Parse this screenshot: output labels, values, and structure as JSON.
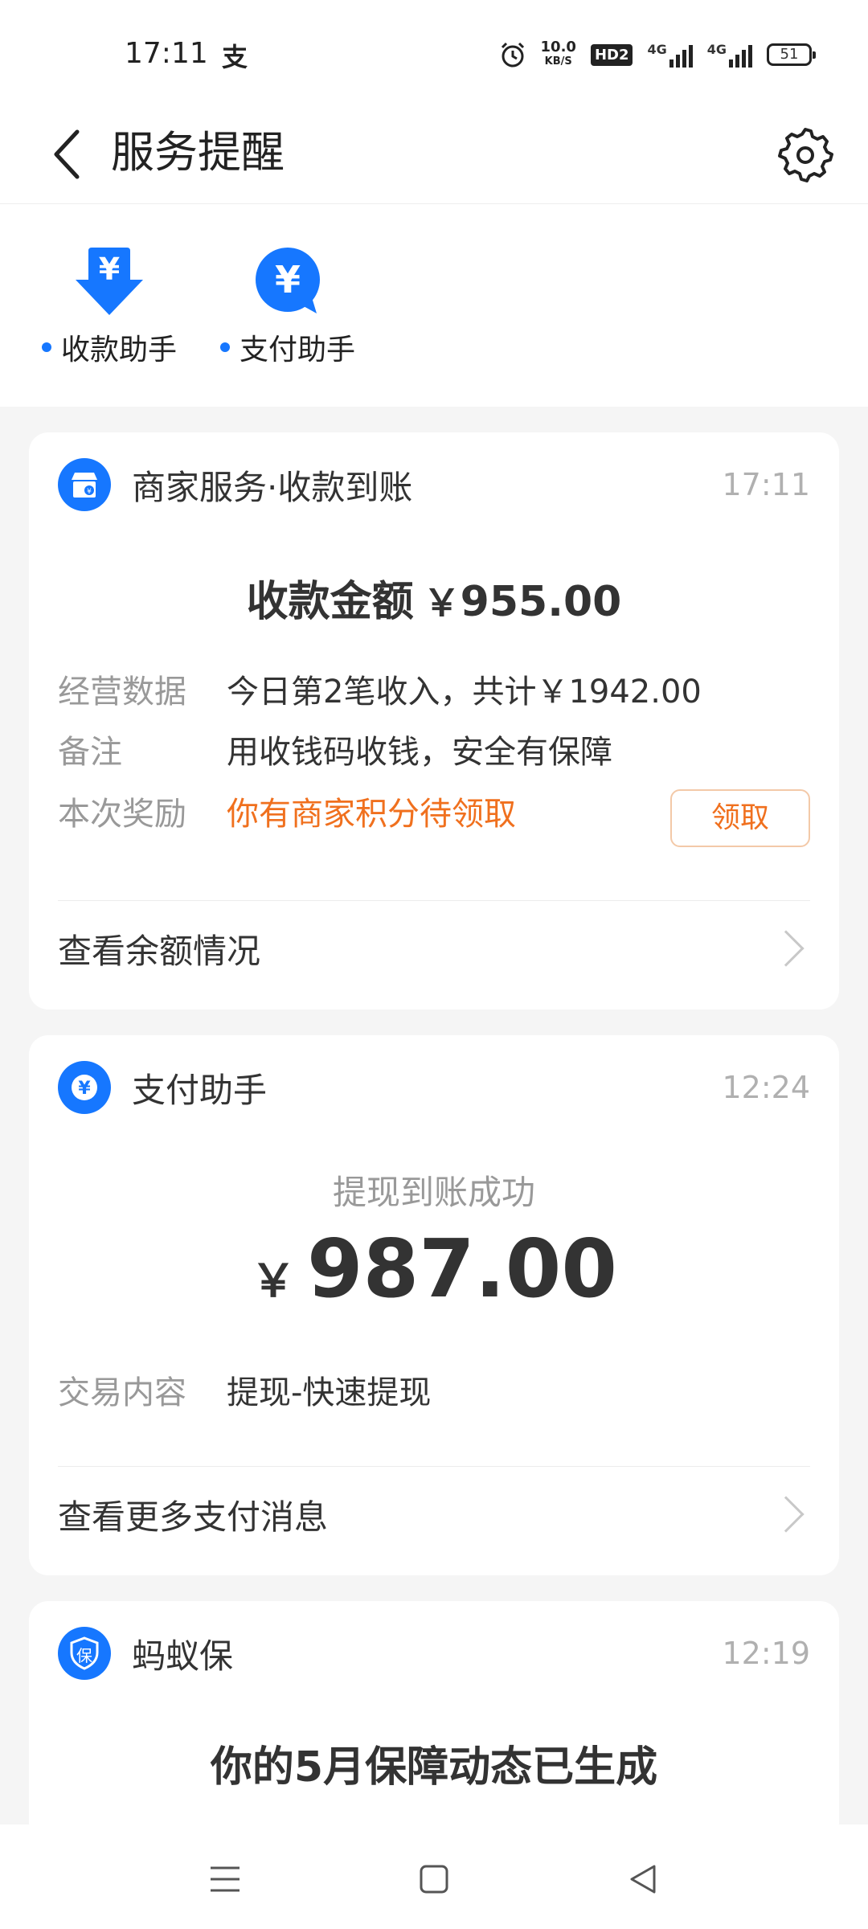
{
  "status_bar": {
    "time": "17:11",
    "app_glyph": "支",
    "net_speed_value": "10.0",
    "net_speed_unit": "KB/S",
    "hd": "HD2",
    "sig1": "4G",
    "sig2": "4G",
    "battery": "51"
  },
  "header": {
    "title": "服务提醒"
  },
  "shortcuts": [
    {
      "label": "收款助手",
      "icon": "receive-download-yuan-icon"
    },
    {
      "label": "支付助手",
      "icon": "pay-yuan-bubble-icon"
    }
  ],
  "cards": {
    "merchant": {
      "title": "商家服务·收款到账",
      "time": "17:11",
      "amount_label": "收款金额",
      "currency": "￥",
      "amount": "955.00",
      "rows": [
        {
          "label": "经营数据",
          "value": "今日第2笔收入，共计￥1942.00"
        },
        {
          "label": "备注",
          "value": "用收钱码收钱，安全有保障"
        },
        {
          "label": "本次奖励",
          "value": "你有商家积分待领取"
        }
      ],
      "claim_button": "领取",
      "link": "查看余额情况"
    },
    "payment": {
      "title": "支付助手",
      "time": "12:24",
      "subtitle": "提现到账成功",
      "currency": "￥",
      "amount": "987.00",
      "row_label": "交易内容",
      "row_value": "提现-快速提现",
      "link": "查看更多支付消息"
    },
    "insurance": {
      "title": "蚂蚁保",
      "icon_text": "保",
      "time": "12:19",
      "headline": "你的5月保障动态已生成"
    }
  },
  "colors": {
    "accent": "#1677ff",
    "reward": "#f0701e",
    "claim_border": "#f3c9a8"
  }
}
